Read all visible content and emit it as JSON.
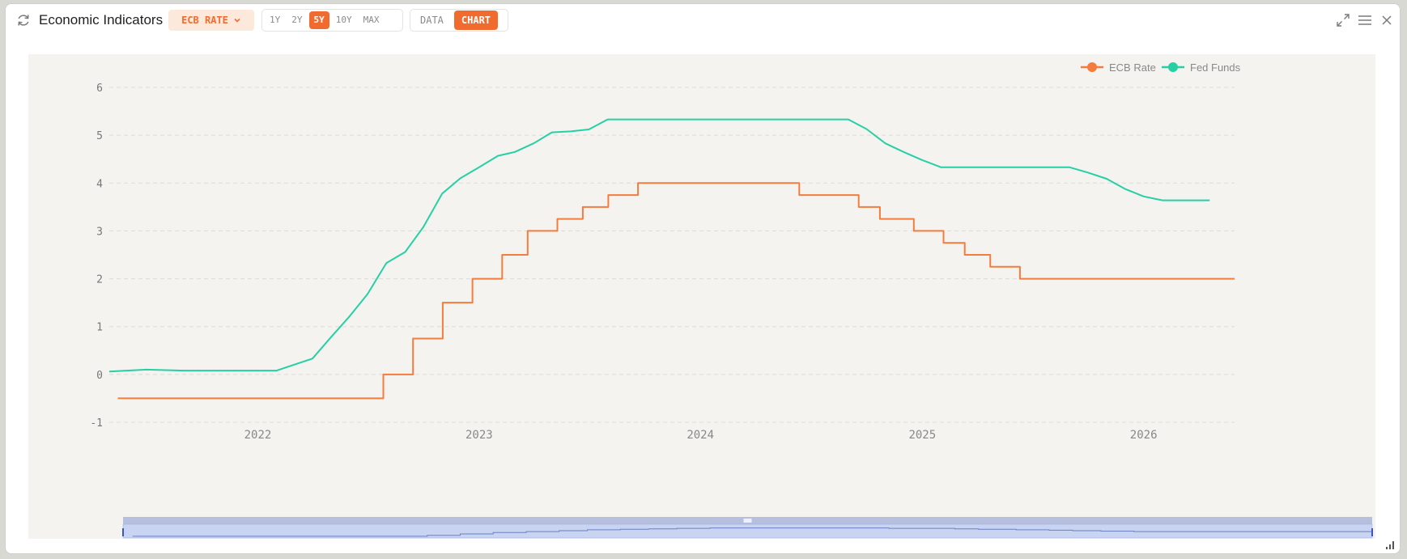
{
  "header": {
    "title": "Economic Indicators",
    "series_selector": "ECB RATE",
    "ranges": [
      "1Y",
      "2Y",
      "5Y",
      "10Y",
      "MAX"
    ],
    "active_range": "5Y",
    "views": [
      "DATA",
      "CHART"
    ],
    "active_view": "CHART",
    "icons": [
      "refresh-icon",
      "chevron-down-icon",
      "expand-icon",
      "menu-icon",
      "close-icon",
      "resize-grip-icon"
    ]
  },
  "colors": {
    "accent": "#f26b2e",
    "ecb": "#f47c3c",
    "fed": "#26d0a4",
    "navigator": "#c8d4f2"
  },
  "chart_data": {
    "type": "line",
    "title": "",
    "xlabel": "",
    "ylabel": "",
    "ylim": [
      -1,
      6
    ],
    "yticks": [
      -1,
      0,
      1,
      2,
      3,
      4,
      5,
      6
    ],
    "xlim": [
      "2021-05-01",
      "2026-05-31"
    ],
    "xticks": [
      "2022",
      "2023",
      "2024",
      "2025",
      "2026"
    ],
    "grid": "horizontal dashed",
    "legend": "top-right",
    "series": [
      {
        "name": "ECB Rate",
        "step": true,
        "color": "#f47c3c",
        "points": [
          [
            "2021-05-15",
            -0.5
          ],
          [
            "2022-07-27",
            0.0
          ],
          [
            "2022-09-14",
            0.75
          ],
          [
            "2022-11-02",
            1.5
          ],
          [
            "2022-12-21",
            2.0
          ],
          [
            "2023-02-08",
            2.5
          ],
          [
            "2023-03-22",
            3.0
          ],
          [
            "2023-05-10",
            3.25
          ],
          [
            "2023-06-21",
            3.5
          ],
          [
            "2023-08-02",
            3.75
          ],
          [
            "2023-09-20",
            4.0
          ],
          [
            "2024-06-12",
            3.75
          ],
          [
            "2024-09-18",
            3.5
          ],
          [
            "2024-10-23",
            3.25
          ],
          [
            "2024-12-18",
            3.0
          ],
          [
            "2025-02-05",
            2.75
          ],
          [
            "2025-03-12",
            2.5
          ],
          [
            "2025-04-23",
            2.25
          ],
          [
            "2025-06-11",
            2.0
          ],
          [
            "2026-05-31",
            2.0
          ]
        ]
      },
      {
        "name": "Fed Funds",
        "step": false,
        "color": "#26d0a4",
        "points": [
          [
            "2021-05-01",
            0.06
          ],
          [
            "2021-07-01",
            0.1
          ],
          [
            "2021-09-01",
            0.08
          ],
          [
            "2021-12-01",
            0.08
          ],
          [
            "2022-02-01",
            0.08
          ],
          [
            "2022-04-01",
            0.33
          ],
          [
            "2022-05-01",
            0.77
          ],
          [
            "2022-06-01",
            1.21
          ],
          [
            "2022-07-01",
            1.68
          ],
          [
            "2022-08-01",
            2.33
          ],
          [
            "2022-09-01",
            2.56
          ],
          [
            "2022-10-01",
            3.08
          ],
          [
            "2022-11-01",
            3.78
          ],
          [
            "2022-12-01",
            4.1
          ],
          [
            "2023-01-01",
            4.33
          ],
          [
            "2023-02-01",
            4.57
          ],
          [
            "2023-03-01",
            4.65
          ],
          [
            "2023-04-01",
            4.83
          ],
          [
            "2023-05-01",
            5.06
          ],
          [
            "2023-06-01",
            5.08
          ],
          [
            "2023-07-01",
            5.12
          ],
          [
            "2023-08-01",
            5.33
          ],
          [
            "2024-09-01",
            5.33
          ],
          [
            "2024-10-01",
            5.13
          ],
          [
            "2024-11-01",
            4.83
          ],
          [
            "2024-12-01",
            4.65
          ],
          [
            "2025-01-01",
            4.48
          ],
          [
            "2025-02-01",
            4.33
          ],
          [
            "2025-09-01",
            4.33
          ],
          [
            "2025-10-01",
            4.22
          ],
          [
            "2025-11-01",
            4.09
          ],
          [
            "2025-12-01",
            3.88
          ],
          [
            "2026-01-01",
            3.72
          ],
          [
            "2026-02-01",
            3.64
          ],
          [
            "2026-04-20",
            3.64
          ]
        ]
      }
    ]
  }
}
